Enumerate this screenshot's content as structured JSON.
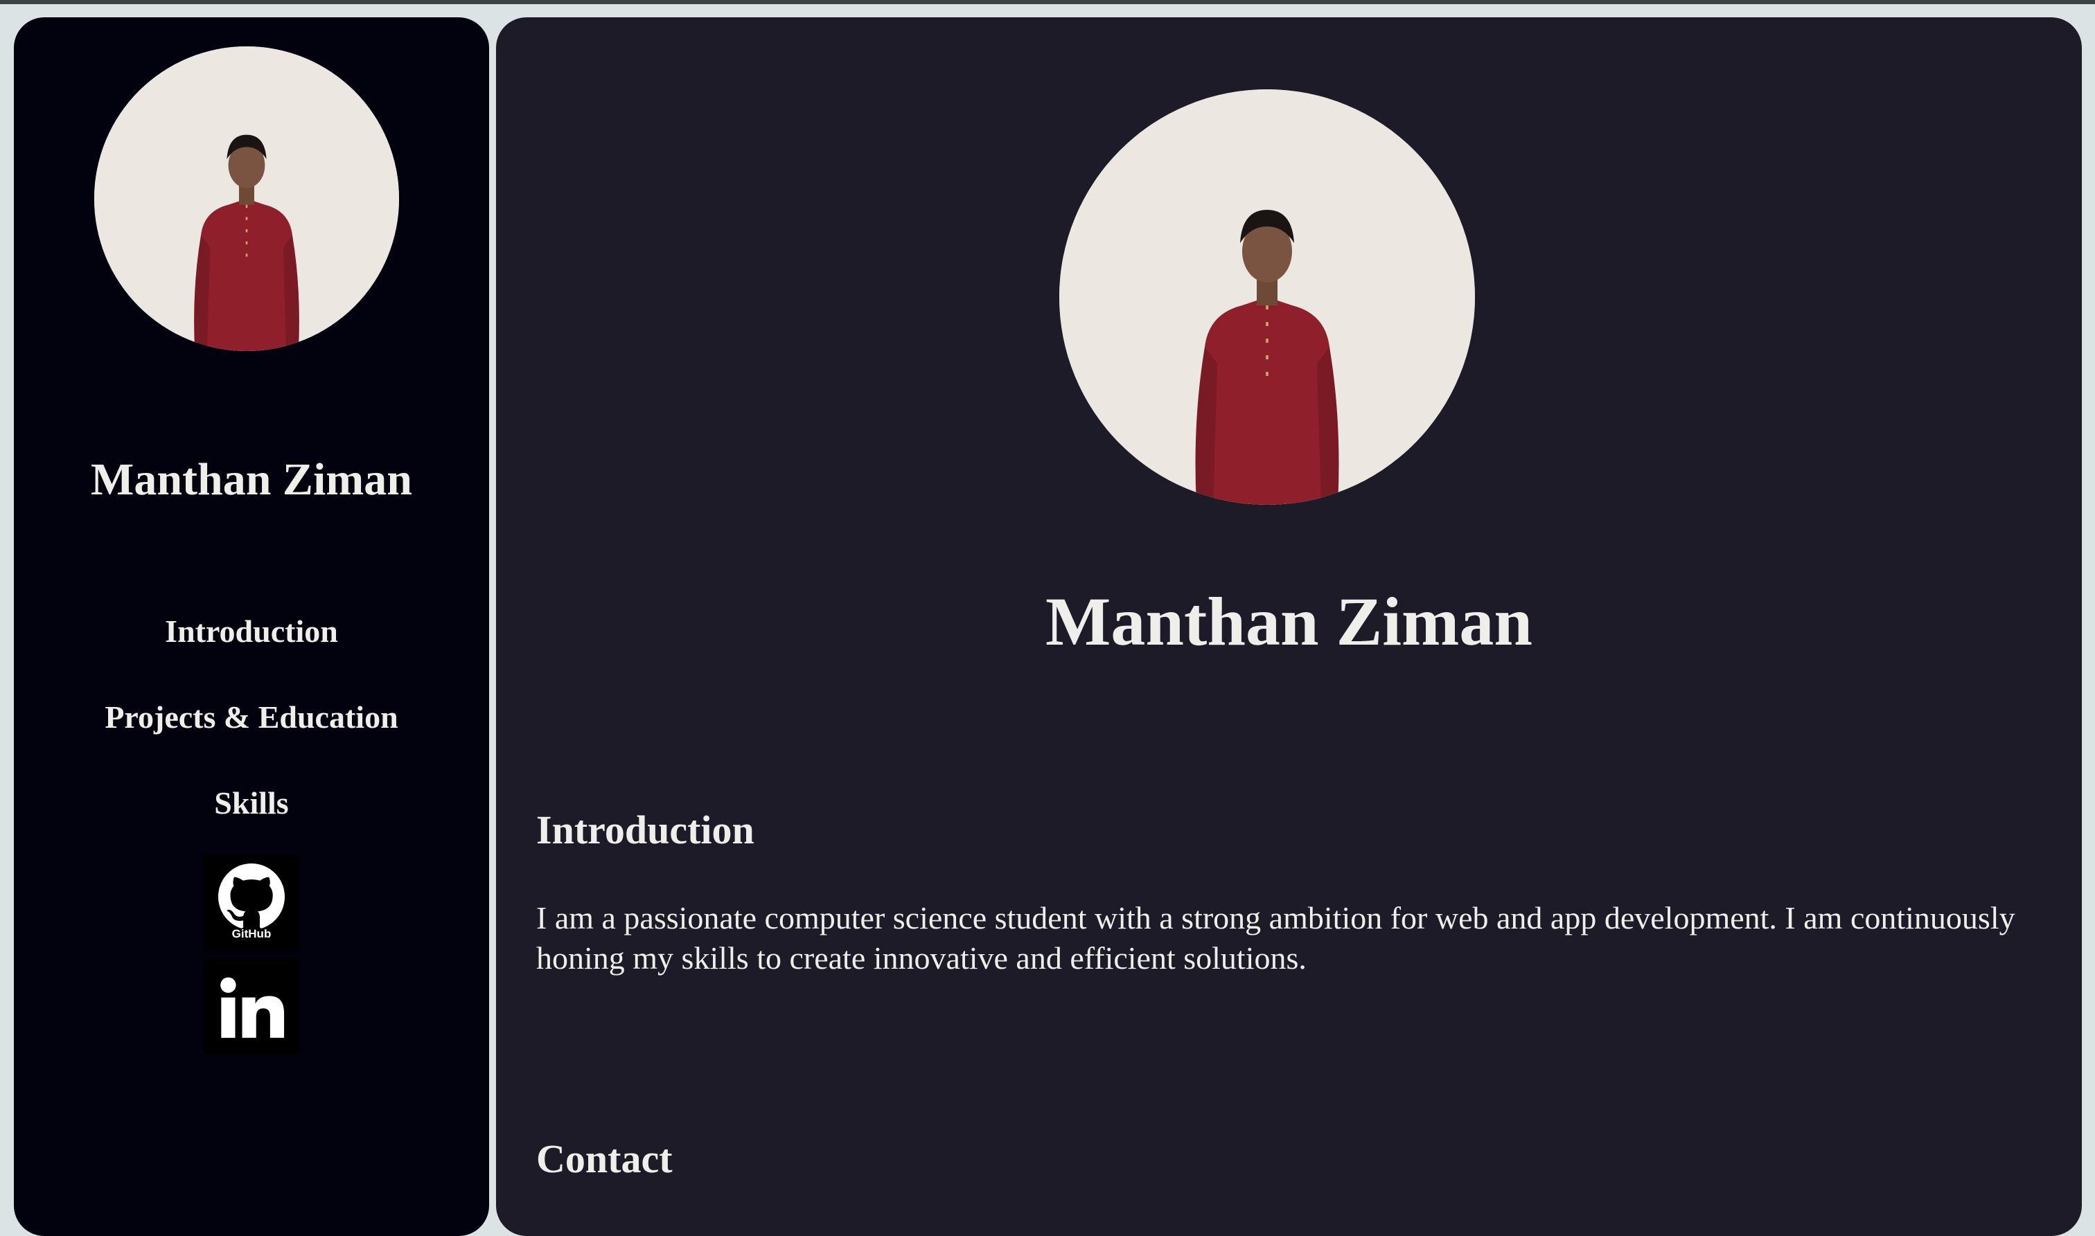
{
  "sidebar": {
    "name": "Manthan Ziman",
    "nav": [
      {
        "label": "Introduction"
      },
      {
        "label": "Projects & Education"
      },
      {
        "label": "Skills"
      }
    ],
    "social": {
      "github": {
        "caption": "GitHub",
        "icon": "github-icon"
      },
      "linkedin": {
        "icon": "linkedin-icon"
      }
    }
  },
  "main": {
    "name": "Manthan Ziman",
    "intro": {
      "title": "Introduction",
      "text": "I am a passionate computer science student with a strong ambition for web and app development. I am continuously honing my skills to create innovative and efficient solutions."
    },
    "contact": {
      "title": "Contact"
    }
  },
  "colors": {
    "page_bg": "#dce3e4",
    "sidebar_bg": "#02020f",
    "main_bg": "#1e1b28",
    "text": "#f0eeea",
    "shirt": "#8e1f2b"
  }
}
